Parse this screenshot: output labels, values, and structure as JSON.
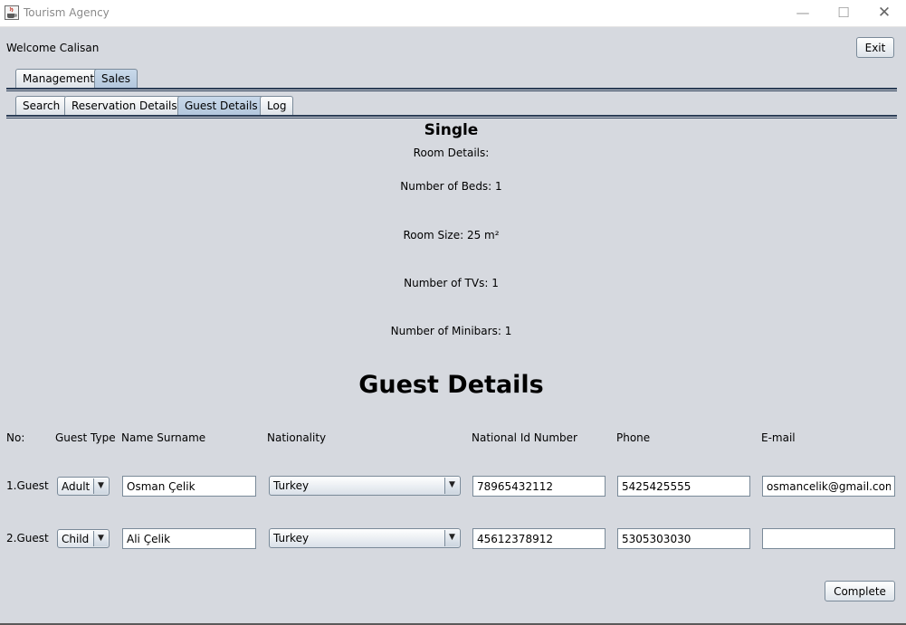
{
  "window": {
    "title": "Tourism Agency"
  },
  "header": {
    "welcome": "Welcome Calisan",
    "exit_label": "Exit"
  },
  "main_tabs": [
    {
      "label": "Management",
      "selected": false
    },
    {
      "label": "Sales",
      "selected": true
    }
  ],
  "sub_tabs": [
    {
      "label": "Search",
      "selected": false
    },
    {
      "label": "Reservation Details",
      "selected": false
    },
    {
      "label": "Guest Details",
      "selected": true
    },
    {
      "label": "Log",
      "selected": false
    }
  ],
  "room": {
    "type": "Single",
    "details_label": "Room Details:",
    "beds": "Number of Beds: 1",
    "size": "Room Size: 25 m²",
    "tvs": "Number of TVs: 1",
    "minibars": "Number of Minibars: 1"
  },
  "guest_section": {
    "title": "Guest Details",
    "columns": {
      "no": "No:",
      "guest_type": "Guest Type",
      "name_surname": "Name Surname",
      "nationality": "Nationality",
      "national_id": "National Id Number",
      "phone": "Phone",
      "email": "E-mail"
    },
    "guests": [
      {
        "no": "1.Guest",
        "guest_type": "Adult",
        "name": "Osman Çelik",
        "nationality": "Turkey",
        "national_id": "78965432112",
        "phone": "5425425555",
        "email": "osmancelik@gmail.com"
      },
      {
        "no": "2.Guest",
        "guest_type": "Child",
        "name": "Ali Çelik",
        "nationality": "Turkey",
        "national_id": "45612378912",
        "phone": "5305303030",
        "email": ""
      }
    ],
    "complete_label": "Complete"
  },
  "icons": {
    "app": "java-cup-icon",
    "minimize": "minimize-icon",
    "maximize": "maximize-icon",
    "close": "close-icon",
    "dropdown": "chevron-down-icon"
  }
}
